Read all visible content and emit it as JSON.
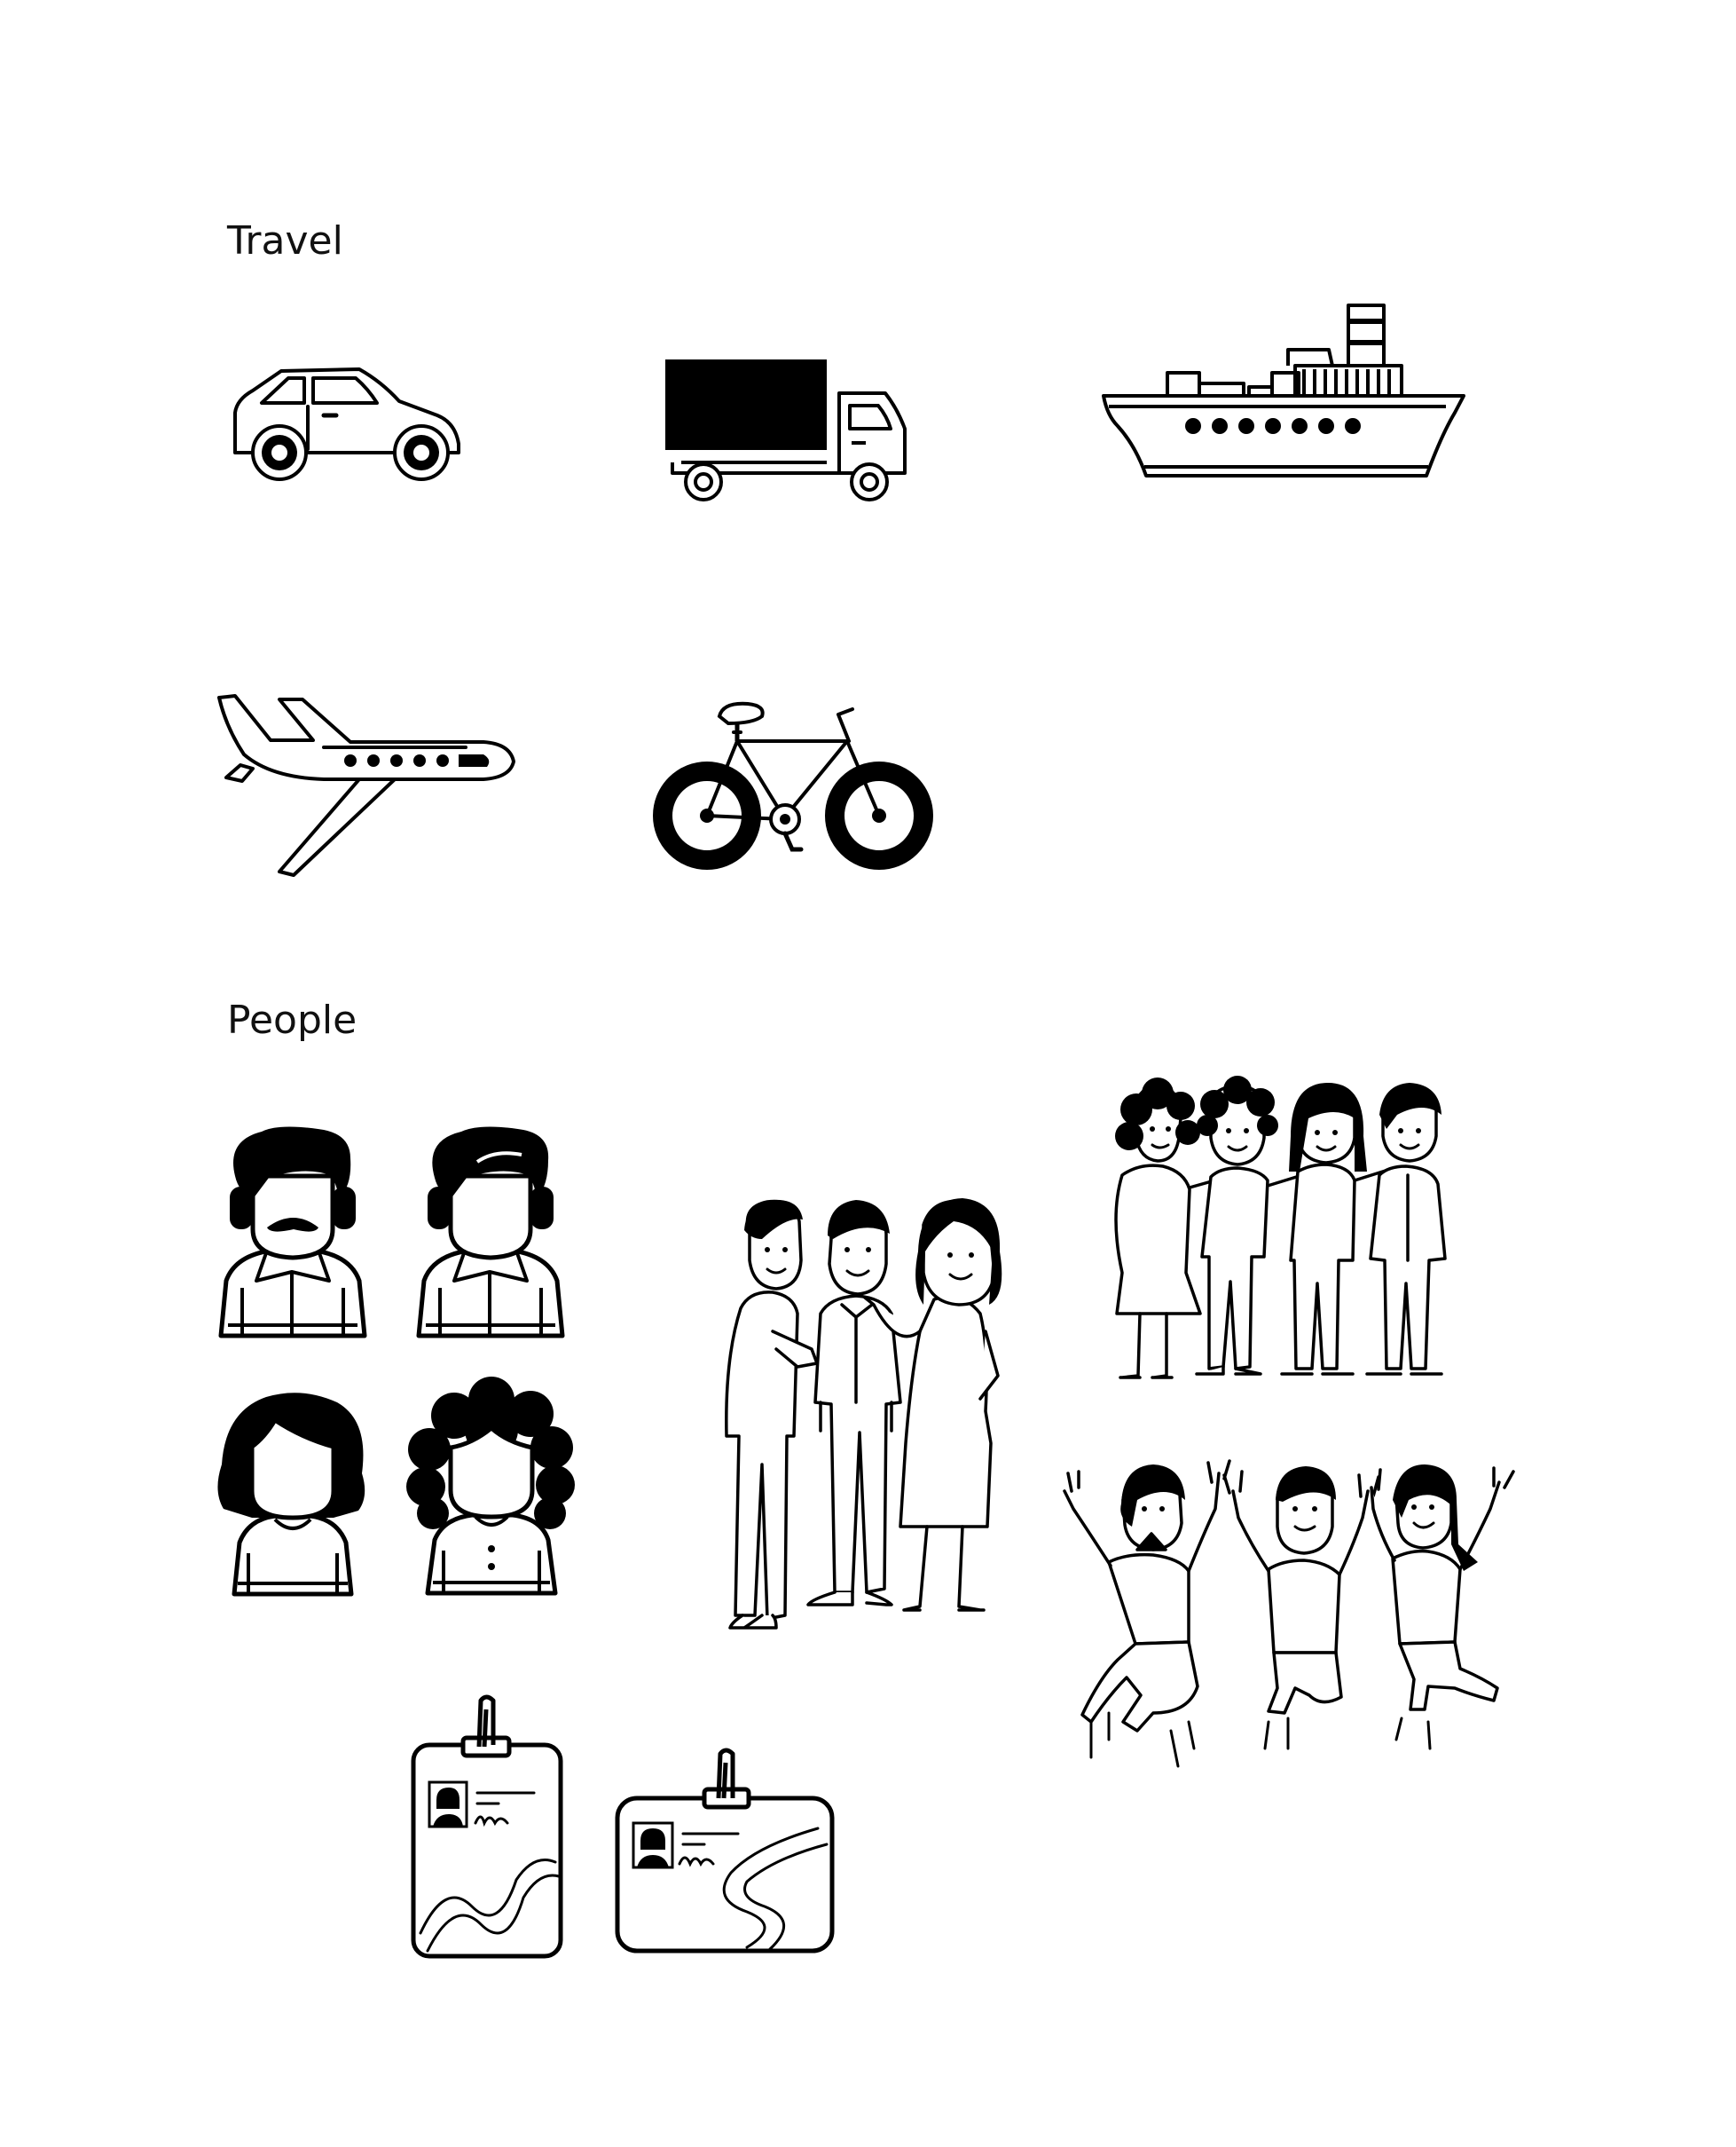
{
  "sections": {
    "travel": {
      "title": "Travel"
    },
    "people": {
      "title": "People"
    }
  },
  "icons": {
    "travel": [
      "car-icon",
      "truck-icon",
      "ship-icon",
      "airplane-icon",
      "bicycle-icon"
    ],
    "people": [
      "man-mustache-icon",
      "man-icon",
      "woman-straight-hair-icon",
      "woman-curly-hair-icon",
      "three-friends-talking-icon",
      "four-friends-hugging-icon",
      "three-people-jumping-icon",
      "id-card-vertical-icon",
      "id-card-horizontal-icon"
    ]
  },
  "colors": {
    "ink": "#000000",
    "paper": "#ffffff"
  }
}
